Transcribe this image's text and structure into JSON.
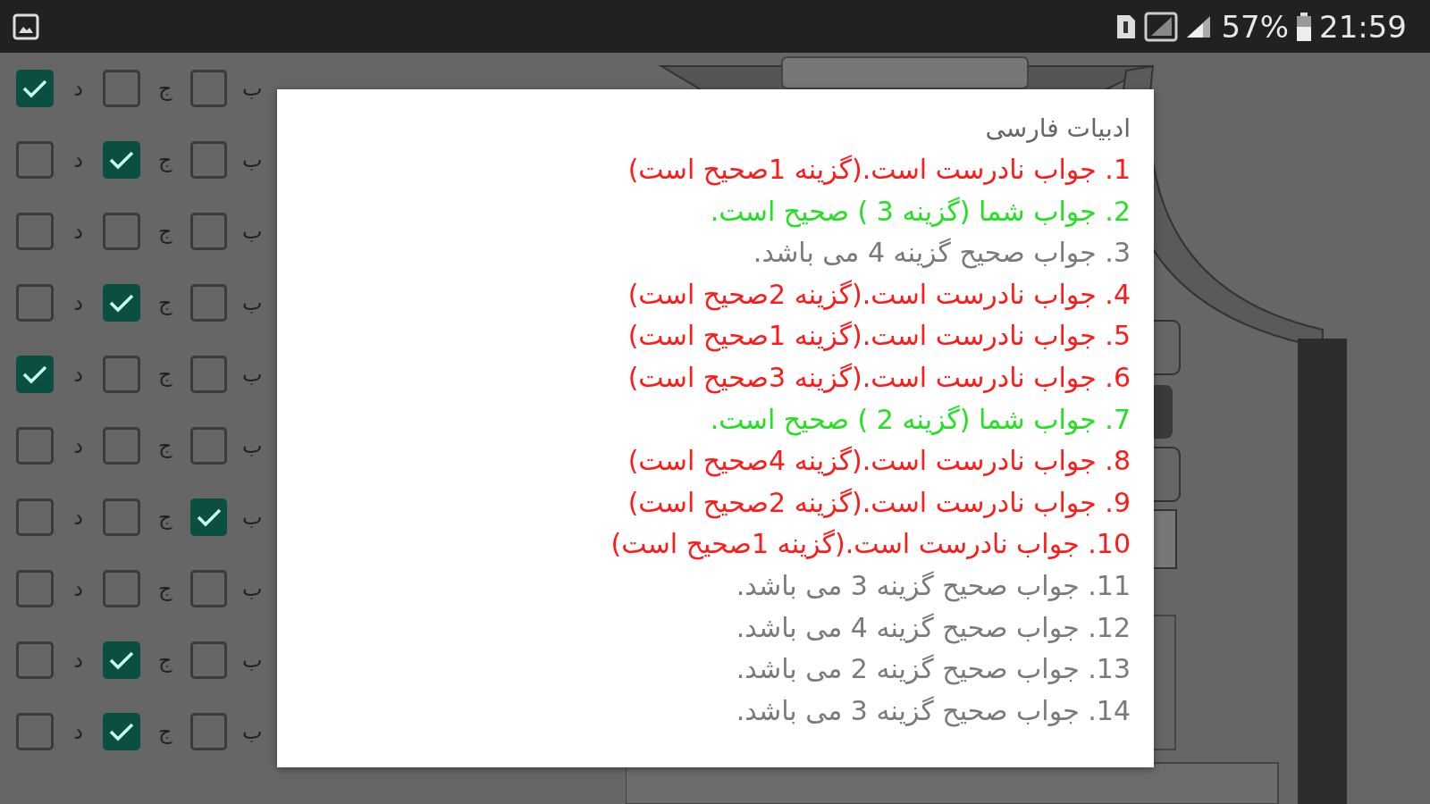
{
  "status_bar": {
    "battery": "57%",
    "time": "21:59"
  },
  "answer_sheet": [
    {
      "options": [
        {
          "label": "ب",
          "checked": false
        },
        {
          "label": "ج",
          "checked": false
        },
        {
          "label": "د",
          "checked": true
        }
      ]
    },
    {
      "options": [
        {
          "label": "ب",
          "checked": false
        },
        {
          "label": "ج",
          "checked": true
        },
        {
          "label": "د",
          "checked": false
        }
      ]
    },
    {
      "options": [
        {
          "label": "ب",
          "checked": false
        },
        {
          "label": "ج",
          "checked": false
        },
        {
          "label": "د",
          "checked": false
        }
      ]
    },
    {
      "options": [
        {
          "label": "ب",
          "checked": false
        },
        {
          "label": "ج",
          "checked": true
        },
        {
          "label": "د",
          "checked": false
        }
      ]
    },
    {
      "options": [
        {
          "label": "ب",
          "checked": false
        },
        {
          "label": "ج",
          "checked": false
        },
        {
          "label": "د",
          "checked": true
        }
      ]
    },
    {
      "options": [
        {
          "label": "ب",
          "checked": false
        },
        {
          "label": "ج",
          "checked": false
        },
        {
          "label": "د",
          "checked": false
        }
      ]
    },
    {
      "options": [
        {
          "label": "ب",
          "checked": true
        },
        {
          "label": "ج",
          "checked": false
        },
        {
          "label": "د",
          "checked": false
        }
      ]
    },
    {
      "options": [
        {
          "label": "ب",
          "checked": false
        },
        {
          "label": "ج",
          "checked": false
        },
        {
          "label": "د",
          "checked": false
        }
      ]
    },
    {
      "options": [
        {
          "label": "ب",
          "checked": false
        },
        {
          "label": "ج",
          "checked": true
        },
        {
          "label": "د",
          "checked": false
        }
      ]
    },
    {
      "options": [
        {
          "label": "ب",
          "checked": false
        },
        {
          "label": "ج",
          "checked": true
        },
        {
          "label": "د",
          "checked": false
        }
      ]
    }
  ],
  "dialog": {
    "title": "ادبیات فارسی",
    "results": [
      {
        "kind": "wrong",
        "text": "1. جواب نادرست است.(گزینه 1صحیح است)"
      },
      {
        "kind": "correct",
        "text": "2. جواب شما (گزینه 3 ) صحیح است."
      },
      {
        "kind": "unanswered",
        "text": "3. جواب صحیح گزینه 4 می باشد."
      },
      {
        "kind": "wrong",
        "text": "4. جواب نادرست است.(گزینه 2صحیح است)"
      },
      {
        "kind": "wrong",
        "text": "5. جواب نادرست است.(گزینه 1صحیح است)"
      },
      {
        "kind": "wrong",
        "text": "6. جواب نادرست است.(گزینه 3صحیح است)"
      },
      {
        "kind": "correct",
        "text": "7. جواب شما (گزینه 2 ) صحیح است."
      },
      {
        "kind": "wrong",
        "text": "8. جواب نادرست است.(گزینه 4صحیح است)"
      },
      {
        "kind": "wrong",
        "text": "9. جواب نادرست است.(گزینه 2صحیح است)"
      },
      {
        "kind": "wrong",
        "text": "10. جواب نادرست است.(گزینه 1صحیح است)"
      },
      {
        "kind": "unanswered",
        "text": "11. جواب صحیح گزینه 3 می باشد."
      },
      {
        "kind": "unanswered",
        "text": "12. جواب صحیح گزینه 4 می باشد."
      },
      {
        "kind": "unanswered",
        "text": "13. جواب صحیح گزینه 2 می باشد."
      },
      {
        "kind": "unanswered",
        "text": "14. جواب صحیح گزینه 3 می باشد."
      }
    ]
  }
}
